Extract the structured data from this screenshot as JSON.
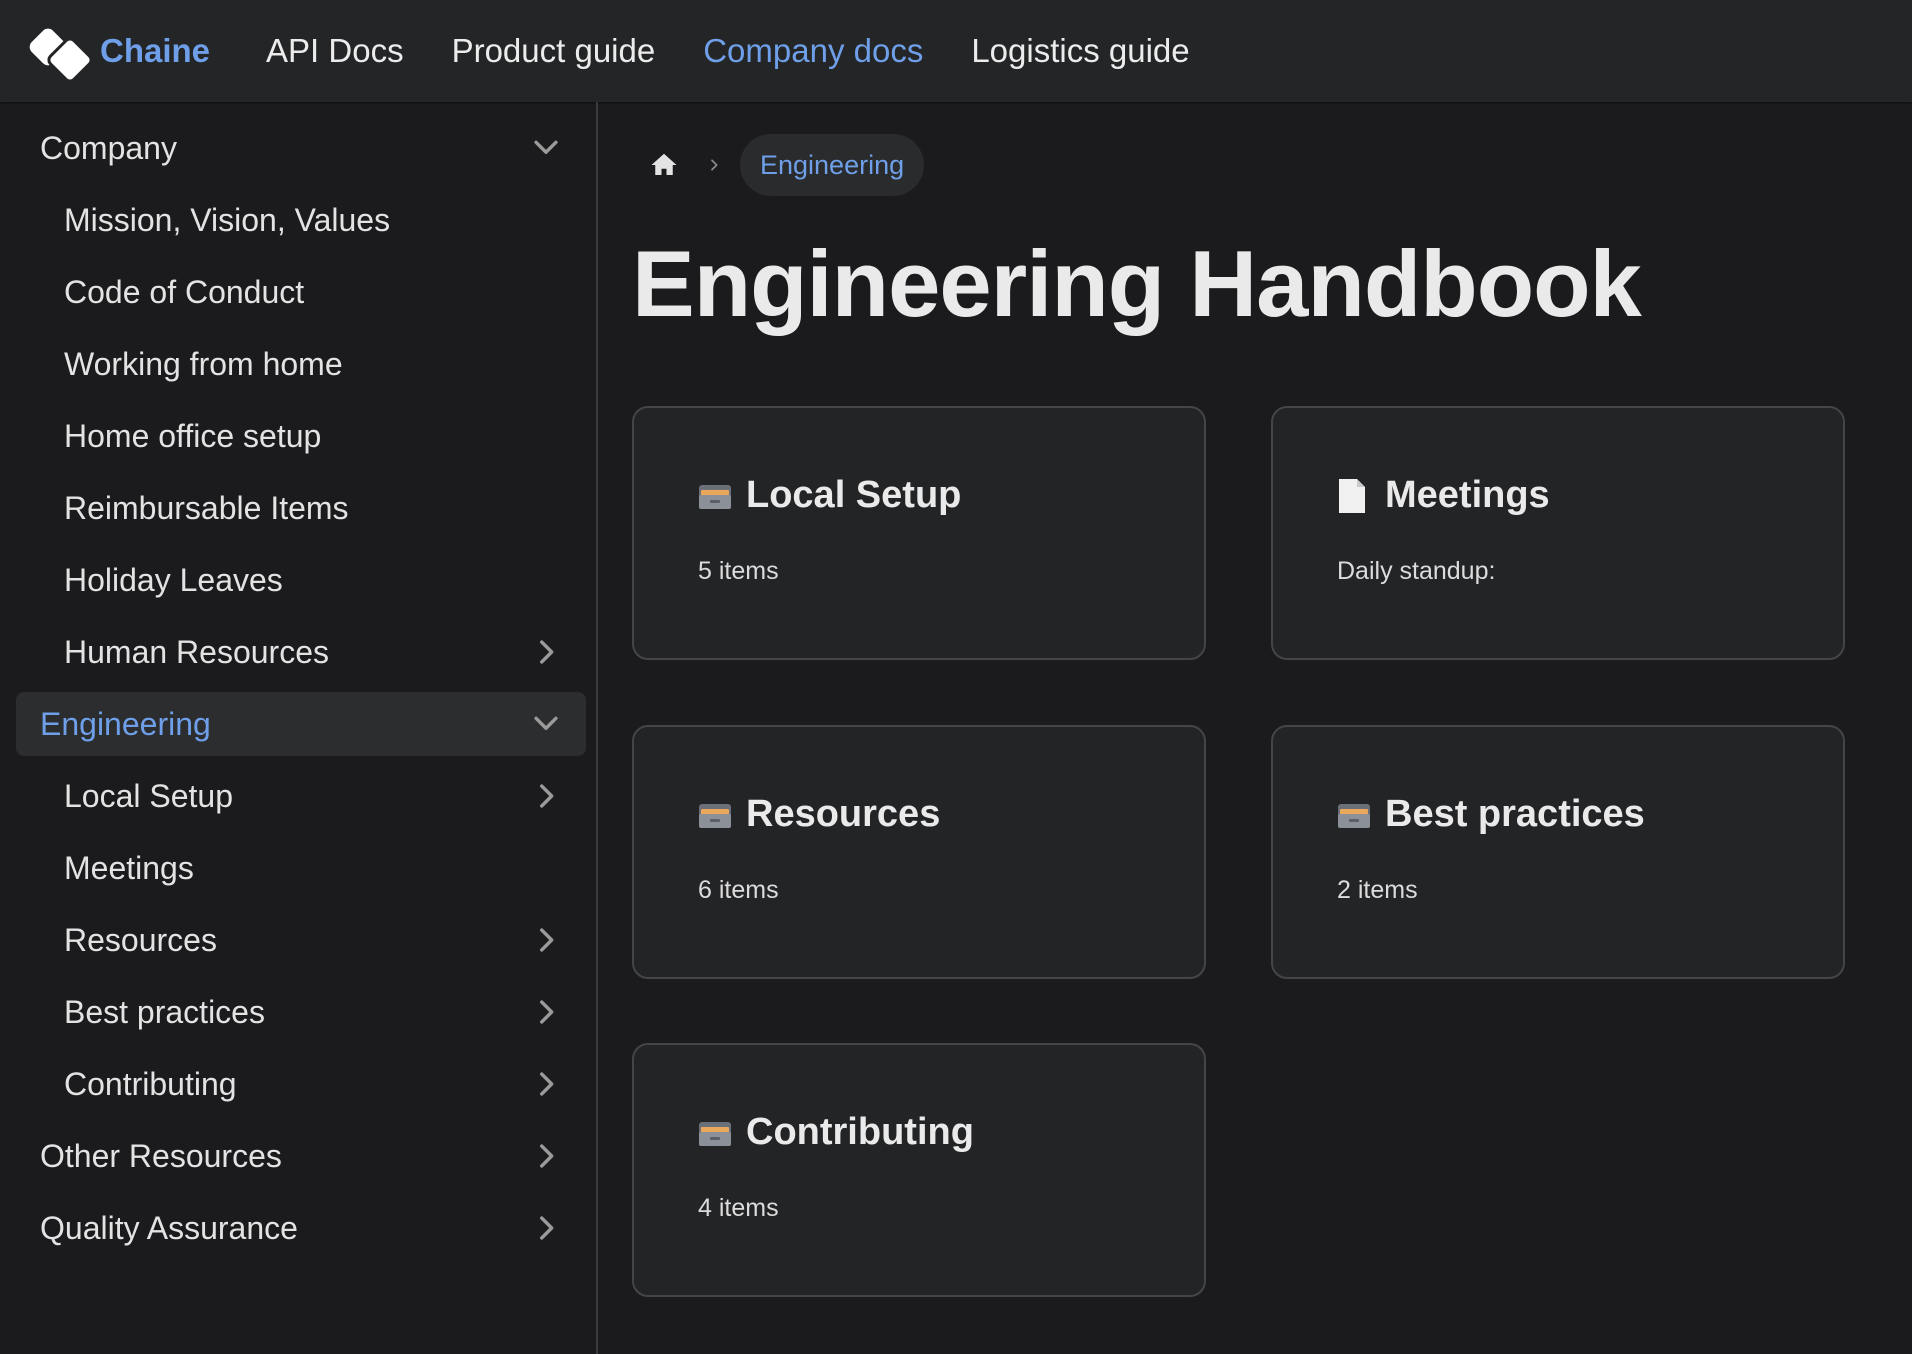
{
  "navbar": {
    "brand": "Chaine",
    "links": [
      "API Docs",
      "Product guide",
      "Company docs",
      "Logistics guide"
    ]
  },
  "sidebar": {
    "items": [
      {
        "label": "Company",
        "caret": "chevron-down"
      },
      {
        "label": "Mission, Vision, Values"
      },
      {
        "label": "Code of Conduct"
      },
      {
        "label": "Working from home"
      },
      {
        "label": "Home office setup"
      },
      {
        "label": "Reimbursable Items"
      },
      {
        "label": "Holiday Leaves"
      },
      {
        "label": "Human Resources",
        "caret": "chevron-right"
      },
      {
        "label": "Engineering",
        "caret": "chevron-down",
        "active": true
      },
      {
        "label": "Local Setup",
        "caret": "chevron-right"
      },
      {
        "label": "Meetings"
      },
      {
        "label": "Resources",
        "caret": "chevron-right"
      },
      {
        "label": "Best practices",
        "caret": "chevron-right"
      },
      {
        "label": "Contributing",
        "caret": "chevron-right"
      },
      {
        "label": "Other Resources",
        "caret": "chevron-right"
      },
      {
        "label": "Quality Assurance",
        "caret": "chevron-right"
      }
    ]
  },
  "breadcrumb": {
    "home_icon": "home-icon",
    "current": "Engineering"
  },
  "page": {
    "title": "Engineering Handbook"
  },
  "cards": [
    {
      "icon": "folder-icon",
      "title": "Local Setup",
      "desc": "5 items"
    },
    {
      "icon": "document-icon",
      "title": "Meetings",
      "desc": "Daily standup:"
    },
    {
      "icon": "folder-icon",
      "title": "Resources",
      "desc": "6 items"
    },
    {
      "icon": "folder-icon",
      "title": "Best practices",
      "desc": "2 items"
    },
    {
      "icon": "folder-icon",
      "title": "Contributing",
      "desc": "4 items"
    }
  ],
  "colors": {
    "accent": "#6e9fe8",
    "background": "#1b1b1d",
    "navbar": "#242526",
    "card": "#232426"
  }
}
